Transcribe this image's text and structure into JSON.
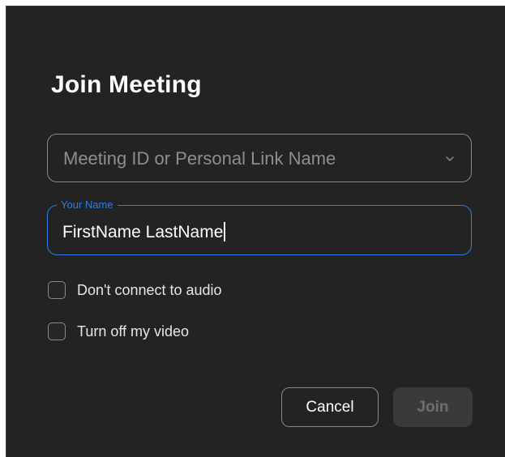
{
  "dialog": {
    "title": "Join Meeting",
    "meeting_id": {
      "placeholder": "Meeting ID or Personal Link Name",
      "value": "",
      "icon": "chevron-down-icon"
    },
    "your_name": {
      "label": "Your Name",
      "value": "FirstName LastName"
    },
    "options": [
      {
        "label": "Don't connect to audio",
        "checked": false
      },
      {
        "label": "Turn off my video",
        "checked": false
      }
    ],
    "buttons": {
      "cancel_label": "Cancel",
      "join_label": "Join",
      "join_enabled": false
    }
  },
  "colors": {
    "background": "#232323",
    "accent": "#2f7ce0",
    "text": "#ffffff",
    "placeholder": "#8e8e8e",
    "disabled_button": "#3a3a3a"
  }
}
